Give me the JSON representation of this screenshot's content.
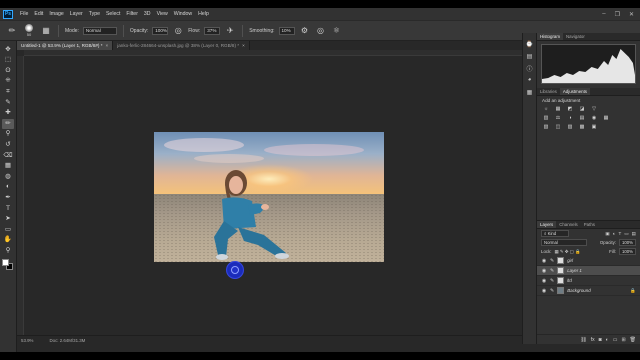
{
  "menu": {
    "logo": "Ps",
    "items": [
      "File",
      "Edit",
      "Image",
      "Layer",
      "Type",
      "Select",
      "Filter",
      "3D",
      "View",
      "Window",
      "Help"
    ],
    "window_controls": [
      "–",
      "❐",
      "✕"
    ]
  },
  "options": {
    "brush_size": "50",
    "mode_label": "Mode:",
    "mode_value": "Normal",
    "opacity_label": "Opacity:",
    "opacity_value": "100%",
    "flow_label": "Flow:",
    "flow_value": "37%",
    "smoothing_label": "Smoothing:",
    "smoothing_value": "10%"
  },
  "tabs": [
    {
      "label": "Untitled-1 @ 53.9% (Layer 1, RGB/8#) *",
      "active": true
    },
    {
      "label": "janko-ferlic-284664-unsplash.jpg @ 38% (Layer 0, RGB/8) *",
      "active": false
    }
  ],
  "tools": [
    "move-icon",
    "marquee-icon",
    "lasso-icon",
    "quick-select-icon",
    "crop-icon",
    "eyedropper-icon",
    "healing-icon",
    "brush-icon",
    "clone-stamp-icon",
    "history-brush-icon",
    "eraser-icon",
    "gradient-icon",
    "blur-icon",
    "dodge-icon",
    "pen-icon",
    "type-icon",
    "path-select-icon",
    "rectangle-icon",
    "hand-icon",
    "zoom-icon"
  ],
  "tool_glyphs": [
    "✥",
    "⬚",
    "ʘ",
    "⁜",
    "⌗",
    "✎",
    "✚",
    "✏",
    "⚲",
    "↺",
    "⌫",
    "▦",
    "◍",
    "◐",
    "✒",
    "T",
    "➤",
    "▭",
    "✋",
    "⚲"
  ],
  "active_tool_index": 7,
  "panels": {
    "histogram_tabs": [
      "Histogram",
      "Navigator"
    ],
    "adjust_tabs": [
      "Libraries",
      "Adjustments"
    ],
    "adjust_title": "Add an adjustment",
    "adjust_icons": [
      "☼",
      "▦",
      "◩",
      "◪",
      "▽",
      "",
      "▥",
      "⚖",
      "◑",
      "▤",
      "◉",
      "▦",
      "▧",
      "◫",
      "▨",
      "▩",
      "▣",
      ""
    ],
    "layer_tabs": [
      "Layers",
      "Channels",
      "Paths"
    ],
    "kind_label": "Kind",
    "blend_mode": "Normal",
    "opacity_label": "Opacity:",
    "opacity_value": "100%",
    "lock_label": "Lock:",
    "fill_label": "Fill:",
    "fill_value": "100%",
    "layers": [
      {
        "name": "girl",
        "selected": false,
        "thumb": "white",
        "locked": false
      },
      {
        "name": "Layer 1",
        "selected": true,
        "thumb": "white",
        "locked": false
      },
      {
        "name": "ltd",
        "selected": false,
        "thumb": "white",
        "locked": false
      },
      {
        "name": "Background",
        "selected": false,
        "thumb": "photo",
        "locked": true
      }
    ]
  },
  "status": {
    "zoom": "53.9%",
    "doc": "Doc: 2.64M/31.3M"
  },
  "colors": {
    "accent": "#31a8ff",
    "cursor": "#1a2bb8"
  }
}
